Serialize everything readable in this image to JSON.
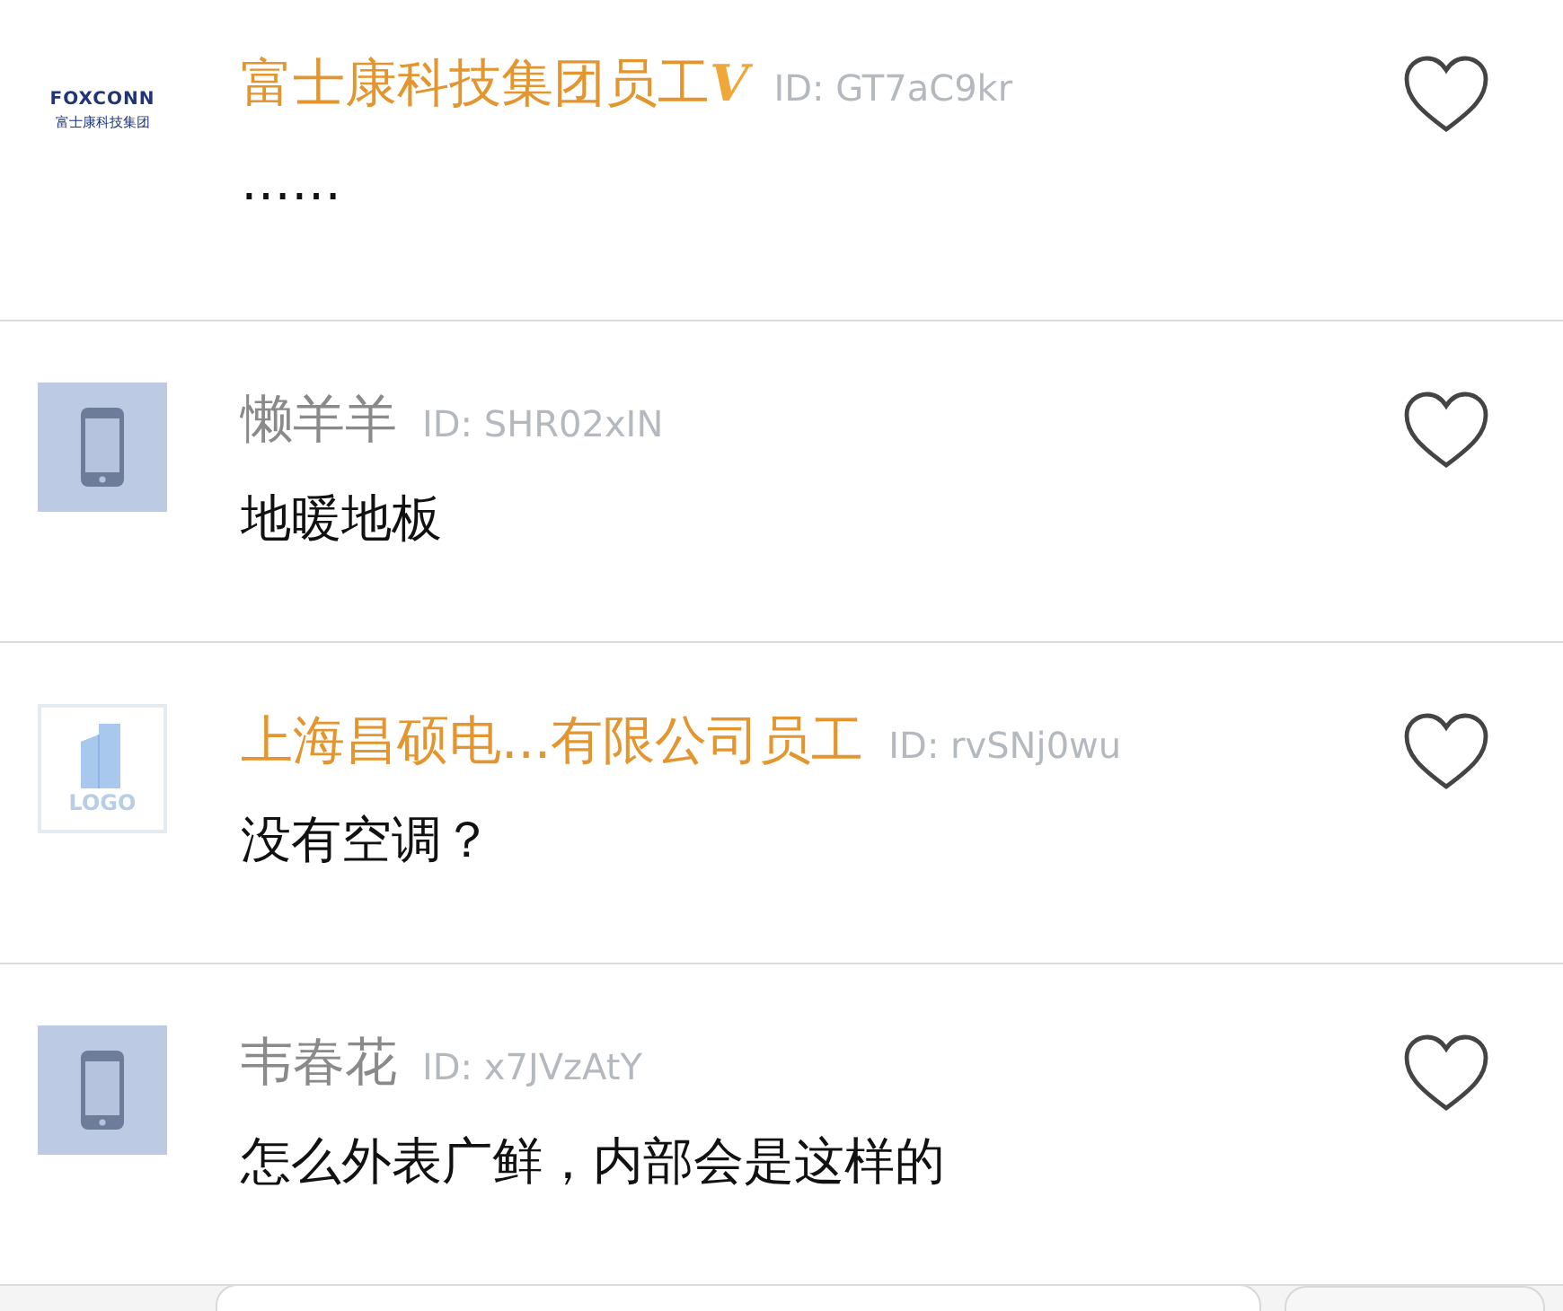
{
  "comments": [
    {
      "avatar": {
        "kind": "logo",
        "title": "FOXCONN",
        "subtitle": "富士康科技集团"
      },
      "name": "富士康科技集团员工",
      "color": "#e3962f",
      "badge": "V",
      "user_id": "ID: GT7aC9kr",
      "text": "……",
      "liked": false
    },
    {
      "avatar": {
        "kind": "phone"
      },
      "name": "懒羊羊",
      "color": "#8a8a8a",
      "user_id": "ID: SHR02xIN",
      "text": "地暖地板",
      "liked": false
    },
    {
      "avatar": {
        "kind": "placeholder",
        "title": "LOGO"
      },
      "name": "上海昌硕电...有限公司员工",
      "color": "#e3962f",
      "user_id": "ID: rvSNj0wu",
      "text": "没有空调？",
      "liked": false
    },
    {
      "avatar": {
        "kind": "phone"
      },
      "name": "韦春花",
      "color": "#8a8a8a",
      "user_id": "ID: x7JVzAtY",
      "text": "怎么外表广鲜，内部会是这样的",
      "liked": false
    }
  ]
}
